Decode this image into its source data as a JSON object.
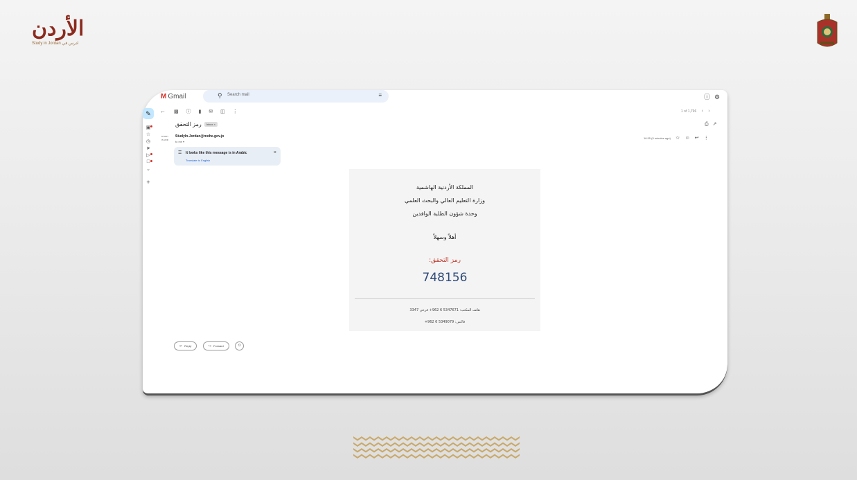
{
  "logo": {
    "arabic": "الأردن",
    "tagline": "Study in Jordan ادرس في"
  },
  "gmail": {
    "brand": "Gmail",
    "search_placeholder": "Search mail",
    "pager": "1 of 1,796",
    "subject": "رمز التحقق",
    "subject_badge": "Inbox ×",
    "avatar_text": "STUDY IN JOR",
    "sender": "StudyIn.Jordan@mohe.gov.jo",
    "to_me": "to me ▾",
    "time": "16:35 (0 minutes ago)",
    "translate": {
      "title": "It looks like this message is in Arabic",
      "link": "Translate to English",
      "close": "×"
    },
    "actions": {
      "reply": "Reply",
      "forward": "Forward"
    }
  },
  "email_body": {
    "line1": "المملكة الأردنية الهاشمية",
    "line2": "وزارة التعليم العالي والبحث العلمي",
    "line3": "وحدة شؤون الطلبة الوافدين",
    "greeting": "أهلاً وسهلاً",
    "code_label": "رمز التحقق:",
    "code": "748156",
    "phone": "هاتف المكتب: 5347671 6 962+ فرعي 3347",
    "fax": "فاكس: 5349079 6 962+"
  },
  "colors": {
    "gmail_red": "#d93025",
    "code_label": "#c0392b",
    "code": "#2e4a7a",
    "logo": "#8b2a1e",
    "ornament": "#c9a96a"
  },
  "icons": [
    "compose-icon",
    "inbox-icon",
    "star-icon",
    "clock-icon",
    "send-icon",
    "label-icon",
    "more-icon",
    "plus-icon",
    "help-icon",
    "settings-icon",
    "print-icon",
    "open-in-new-icon",
    "reply-icon",
    "forward-icon",
    "emoji-icon"
  ]
}
